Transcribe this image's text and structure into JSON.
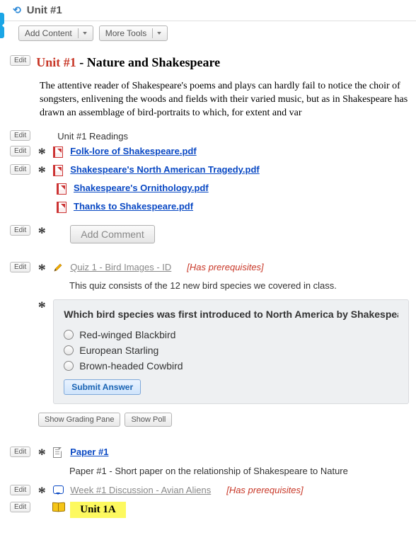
{
  "header": {
    "title": "Unit #1"
  },
  "toolbar": {
    "add_content": "Add Content",
    "more_tools": "More Tools"
  },
  "labels": {
    "edit": "Edit"
  },
  "unit_heading": {
    "red": "Unit #1",
    "sep": " - ",
    "black": "Nature and Shakespeare"
  },
  "intro_paragraph": "The attentive reader of Shakespeare's poems and plays can hardly fail to notice the choir of songsters, enlivening the woods and fields with their varied music, but as in Shakespeare has drawn an assemblage of bird-portraits to which, for extent and var",
  "readings_label": "Unit #1 Readings",
  "readings": {
    "r0": "Folk-lore of Shakespeare.pdf",
    "r1": "Shakespeare's North American Tragedy.pdf",
    "r2": "Shakespeare's Ornithology.pdf",
    "r3": "Thanks to Shakespeare.pdf"
  },
  "add_comment": "Add Comment",
  "quiz": {
    "title": "Quiz 1 - Bird Images - ID",
    "prereq": "[Has prerequisites]",
    "desc": "This quiz consists of the 12 new bird species we covered in class."
  },
  "question": {
    "prompt": "Which bird species was first introduced to North America by Shakespeare e",
    "opt0": "Red-winged Blackbird",
    "opt1": "European Starling",
    "opt2": "Brown-headed Cowbird",
    "submit": "Submit Answer"
  },
  "panel_buttons": {
    "grading": "Show Grading Pane",
    "poll": "Show Poll"
  },
  "paper": {
    "title": "Paper #1",
    "desc": "Paper #1 - Short paper on the relationship of Shakespeare to Nature"
  },
  "discussion": {
    "title": "Week #1 Discussion - Avian Aliens",
    "prereq": "[Has prerequisites]"
  },
  "sub_unit": "Unit 1A"
}
